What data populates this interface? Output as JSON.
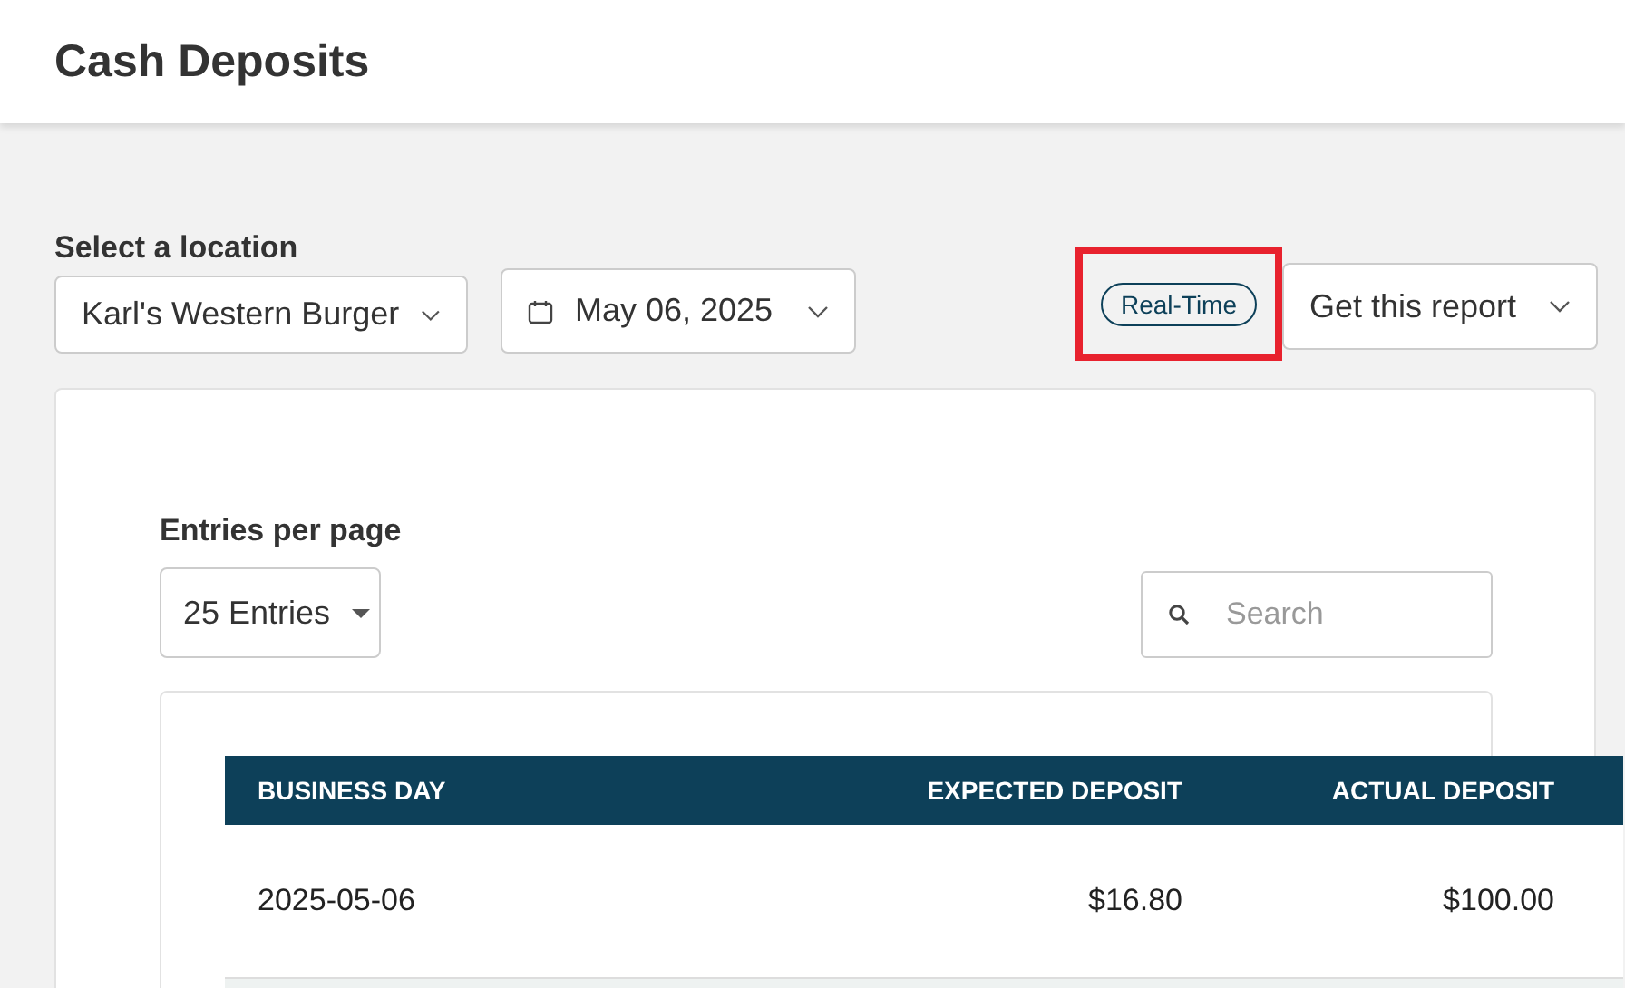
{
  "page": {
    "title": "Cash Deposits"
  },
  "location": {
    "label": "Select a location",
    "value": "Karl's Western Burger"
  },
  "date_picker": {
    "value": "May 06, 2025"
  },
  "realtime_badge": {
    "label": "Real-Time",
    "highlighted": true
  },
  "report_menu": {
    "label": "Get this report"
  },
  "entries": {
    "label": "Entries per page",
    "value": "25 Entries"
  },
  "search": {
    "placeholder": "Search"
  },
  "table": {
    "columns": [
      {
        "label": "BUSINESS DAY"
      },
      {
        "label": "EXPECTED DEPOSIT"
      },
      {
        "label": "ACTUAL DEPOSIT"
      }
    ],
    "rows": [
      [
        "2025-05-06",
        "$16.80",
        "$100.00"
      ]
    ]
  }
}
